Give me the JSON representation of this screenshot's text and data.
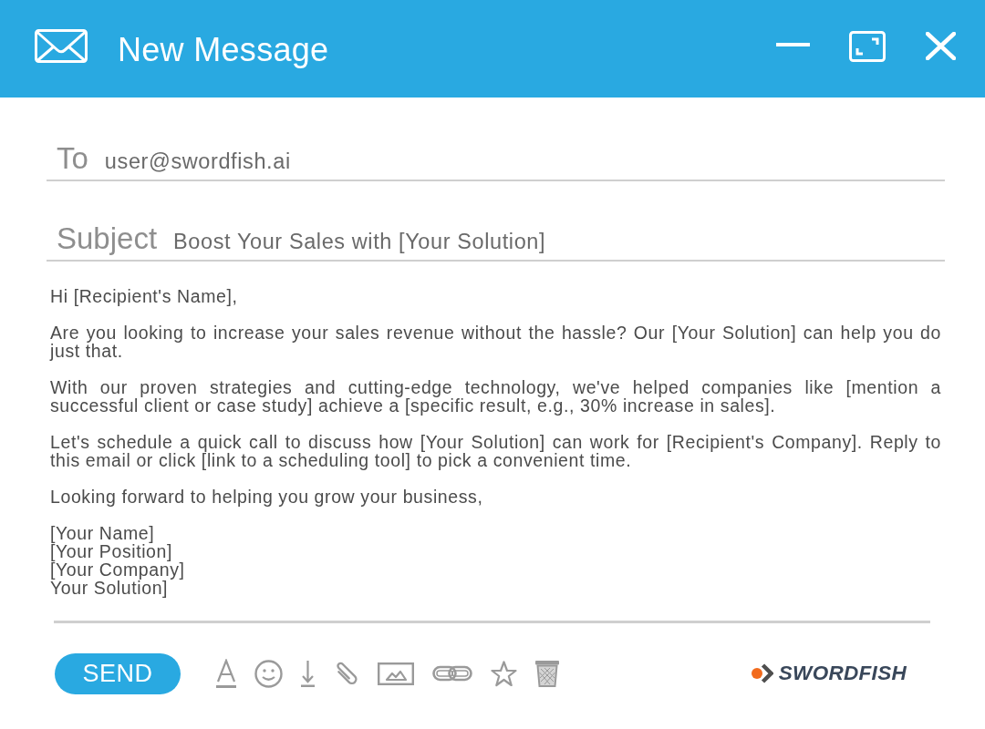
{
  "window": {
    "title": "New Message"
  },
  "fields": [
    {
      "label": "To",
      "value": "user@swordfish.ai"
    },
    {
      "label": "Subject",
      "value": "Boost Your Sales with [Your Solution]"
    }
  ],
  "body": {
    "paragraphs": [
      "Hi [Recipient's Name],",
      "Are you looking to increase your sales revenue without the hassle? Our [Your Solution] can help you do just that.",
      "With our proven strategies and cutting-edge technology, we've helped companies like [mention a successful client or case study] achieve a [specific result, e.g., 30% increase in sales].",
      "Let's schedule a quick call to discuss how [Your Solution] can work for [Recipient's Company]. Reply to this email or click [link to a scheduling tool] to pick a convenient time.",
      "Looking forward to helping you grow your business,"
    ],
    "signature": [
      "[Your Name]",
      "[Your Position]",
      "[Your Company]",
      "Your Solution]"
    ]
  },
  "send_button": {
    "label": "SEND"
  },
  "logo": {
    "text": "SWORDFISH"
  }
}
